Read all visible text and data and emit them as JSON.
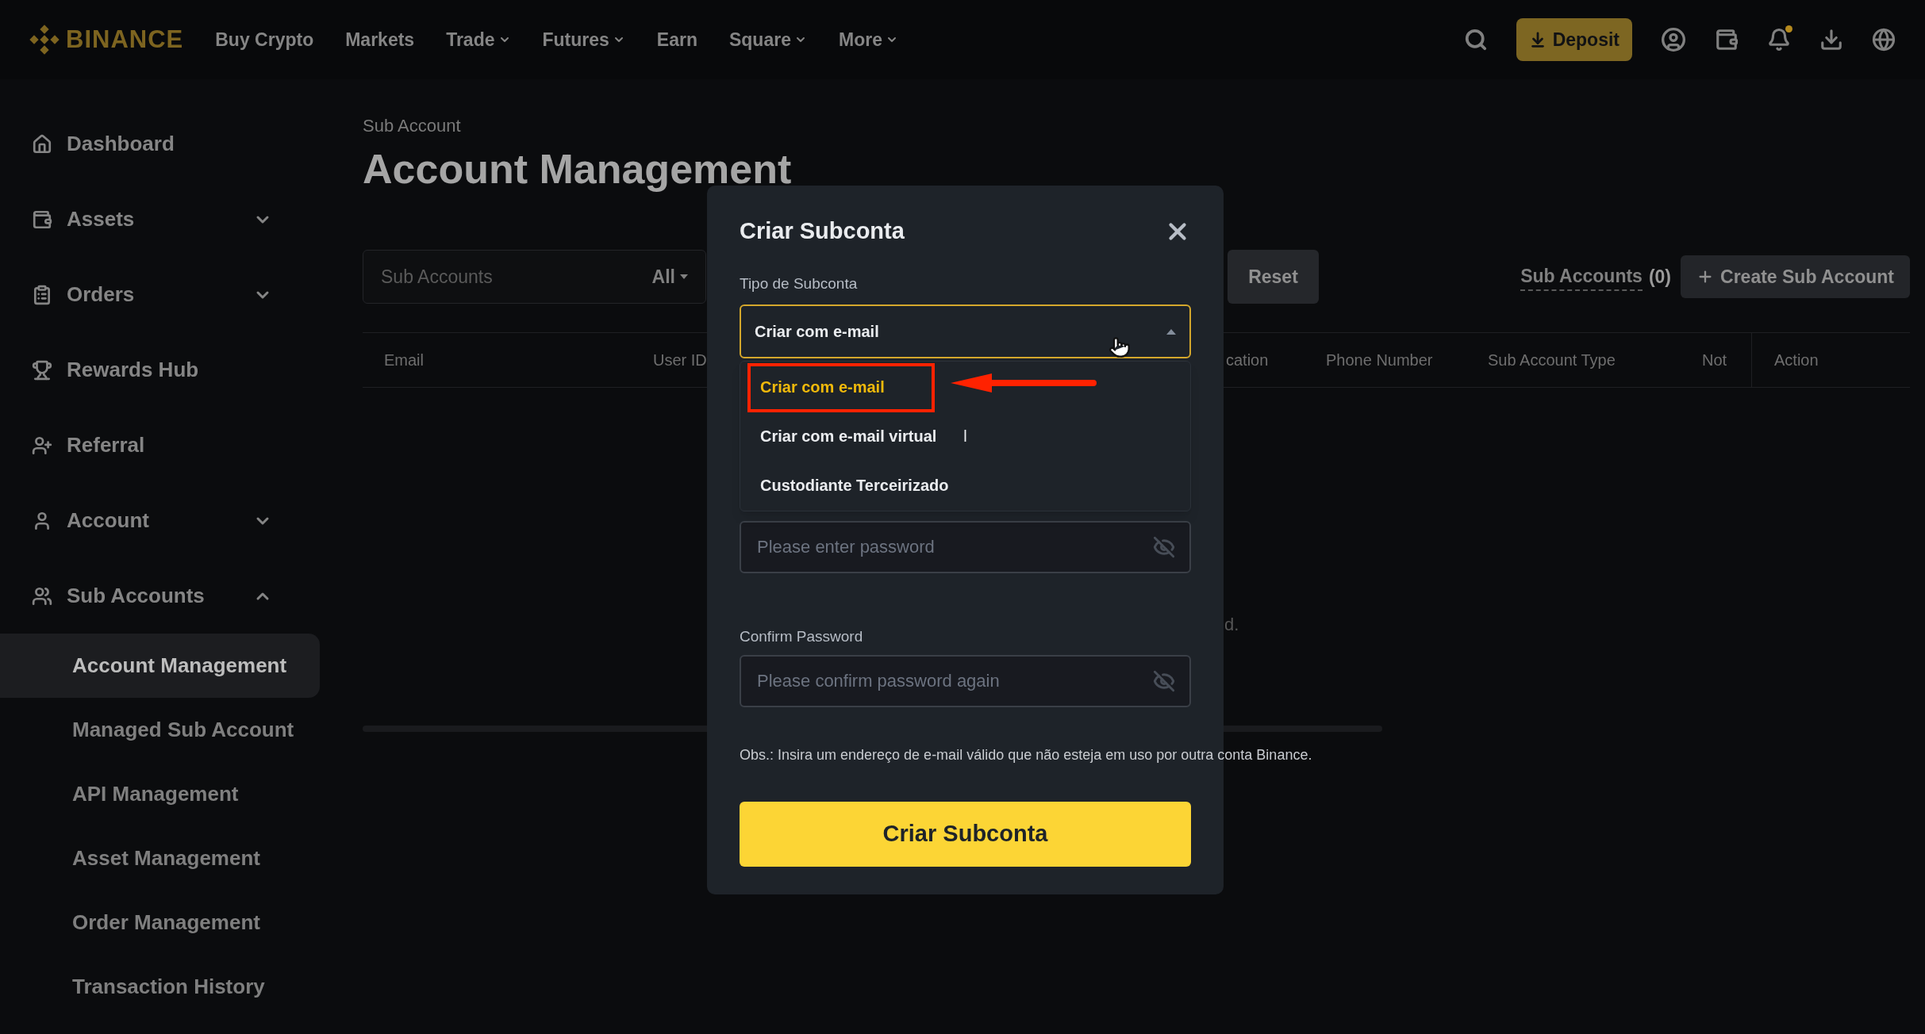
{
  "header": {
    "logo": "BINANCE",
    "nav": [
      {
        "label": "Buy Crypto",
        "dropdown": false
      },
      {
        "label": "Markets",
        "dropdown": false
      },
      {
        "label": "Trade",
        "dropdown": true
      },
      {
        "label": "Futures",
        "dropdown": true
      },
      {
        "label": "Earn",
        "dropdown": false
      },
      {
        "label": "Square",
        "dropdown": true
      },
      {
        "label": "More",
        "dropdown": true
      }
    ],
    "deposit": "Deposit",
    "notification_dot": true
  },
  "sidebar": {
    "items": [
      {
        "label": "Dashboard"
      },
      {
        "label": "Assets",
        "expanded": false
      },
      {
        "label": "Orders",
        "expanded": false
      },
      {
        "label": "Rewards Hub"
      },
      {
        "label": "Referral"
      },
      {
        "label": "Account",
        "expanded": false
      },
      {
        "label": "Sub Accounts",
        "expanded": true,
        "children": [
          {
            "label": "Account Management",
            "selected": true
          },
          {
            "label": "Managed Sub Account",
            "selected": false
          },
          {
            "label": "API Management",
            "selected": false
          },
          {
            "label": "Asset Management",
            "selected": false
          },
          {
            "label": "Order Management",
            "selected": false
          },
          {
            "label": "Transaction History",
            "selected": false
          }
        ]
      }
    ]
  },
  "main": {
    "breadcrumb": "Sub Account",
    "title": "Account Management",
    "filter": {
      "placeholder": "Sub Accounts",
      "select": "All"
    },
    "reset": "Reset",
    "sub_accounts_link": "Sub Accounts",
    "sub_accounts_count": "(0)",
    "create_button": "Create Sub Account",
    "table": {
      "columns": [
        "Email",
        "User ID",
        "cation",
        "Phone Number",
        "Sub Account Type",
        "Not",
        "Action"
      ],
      "empty_message": "d."
    }
  },
  "modal": {
    "title": "Criar Subconta",
    "type_label": "Tipo de Subconta",
    "type_value": "Criar com e-mail",
    "dropdown_open": true,
    "options": [
      {
        "label": "Criar com e-mail",
        "selected": true
      },
      {
        "label": "Criar com e-mail virtual",
        "selected": false,
        "stray_mark": "l"
      },
      {
        "label": "Custodiante Terceirizado",
        "selected": false
      }
    ],
    "password_placeholder": "Please enter password",
    "confirm_label": "Confirm Password",
    "confirm_placeholder": "Please confirm password again",
    "note": "Obs.: Insira um endereço de e-mail válido que não esteja em uso por outra conta Binance.",
    "submit": "Criar Subconta"
  }
}
